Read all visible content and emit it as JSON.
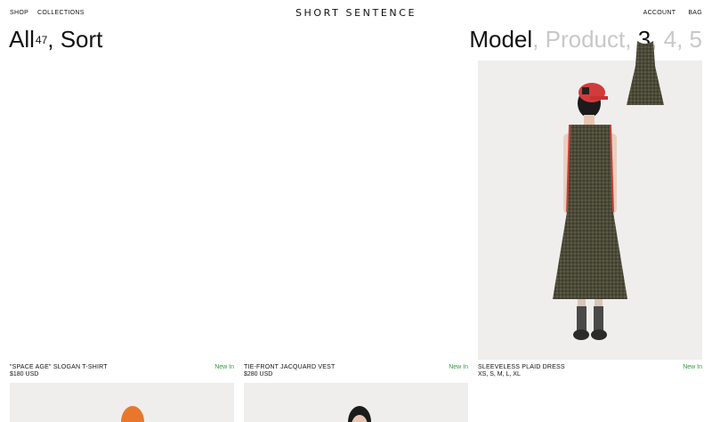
{
  "nav": {
    "shop": "SHOP",
    "collections": "COLLECTIONS",
    "account": "ACCOUNT",
    "bag": "BAG"
  },
  "brand": {
    "logo": "SHORT SENTENCE"
  },
  "listing": {
    "all_label": "All",
    "count": "47",
    "sort_label": "Sort"
  },
  "view_options": {
    "model": "Model",
    "product": "Product",
    "three": "3",
    "four": "4",
    "five": "5",
    "active": "Model"
  },
  "products": [
    {
      "title": "\"SPACE AGE\" SLOGAN T-SHIRT",
      "price": "$180 USD",
      "badge": "New In"
    },
    {
      "title": "TIE-FRONT JACQUARD VEST",
      "price": "$280 USD",
      "badge": "New In"
    },
    {
      "title": "SLEEVELESS PLAID DRESS",
      "price": "XS, S, M, L, XL",
      "badge": "New In"
    }
  ],
  "colors": {
    "badge_green": "#2f9a3c",
    "dim_text": "#c8c8c8",
    "image_bg": "#efeeec"
  },
  "icons": [
    "hat-icon"
  ]
}
